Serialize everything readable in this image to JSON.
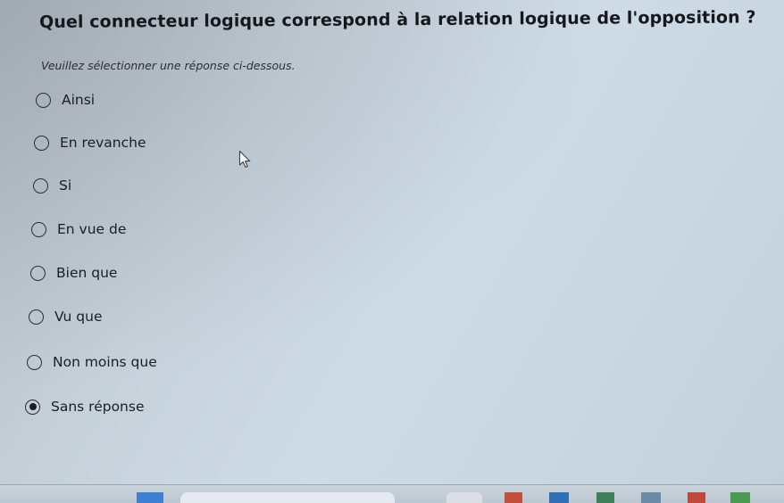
{
  "question": {
    "title": "Quel connecteur logique correspond à la relation logique de l'opposition ?",
    "instruction": "Veuillez sélectionner une réponse ci-dessous."
  },
  "options": [
    {
      "label": "Ainsi",
      "selected": false
    },
    {
      "label": "En revanche",
      "selected": false
    },
    {
      "label": "Si",
      "selected": false
    },
    {
      "label": "En vue de",
      "selected": false
    },
    {
      "label": "Bien que",
      "selected": false
    },
    {
      "label": "Vu que",
      "selected": false
    },
    {
      "label": "Non moins que",
      "selected": false
    },
    {
      "label": "Sans réponse",
      "selected": true
    }
  ],
  "icons": {
    "cursor": "mouse-pointer-icon",
    "option_unselected": "radio-empty-icon",
    "option_selected": "radio-filled-icon"
  },
  "colors": {
    "background": "#c6d1da",
    "text": "#1b1e22",
    "radio_border": "#2b2f34"
  }
}
